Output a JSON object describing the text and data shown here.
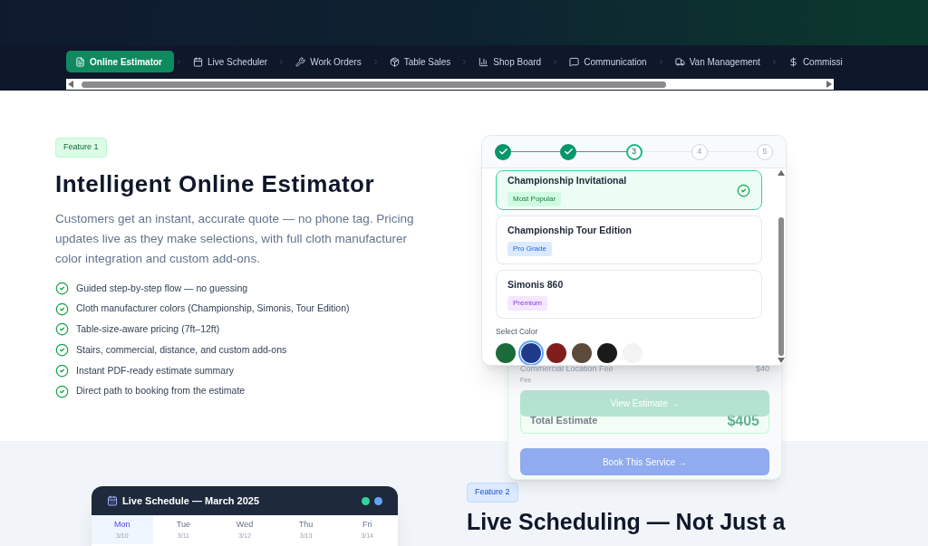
{
  "nav": {
    "tabs": [
      {
        "label": "Online Estimator",
        "selected": true
      },
      {
        "label": "Live Scheduler",
        "selected": false
      },
      {
        "label": "Work Orders",
        "selected": false
      },
      {
        "label": "Table Sales",
        "selected": false
      },
      {
        "label": "Shop Board",
        "selected": false
      },
      {
        "label": "Communication",
        "selected": false
      },
      {
        "label": "Van Management",
        "selected": false
      },
      {
        "label": "Commissi",
        "selected": false
      }
    ]
  },
  "feature_1": {
    "badge": "Feature 1",
    "title": "Intelligent Online Estimator",
    "description": "Customers get an instant, accurate quote — no phone tag. Pricing updates live as they make selections, with full cloth manufacturer color integration and custom add-ons.",
    "checklist": [
      "Guided step-by-step flow — no guessing",
      "Cloth manufacturer colors (Championship, Simonis, Tour Edition)",
      "Table-size-aware pricing (7ft–12ft)",
      "Stairs, commercial, distance, and custom add-ons",
      "Instant PDF-ready estimate summary",
      "Direct path to booking from the estimate"
    ]
  },
  "estimator": {
    "steps": [
      {
        "kind": "done"
      },
      {
        "kind": "done"
      },
      {
        "kind": "current",
        "label": "3"
      },
      {
        "kind": "upcoming",
        "label": "4"
      },
      {
        "kind": "upcoming",
        "label": "5"
      }
    ],
    "cloths": [
      {
        "name": "Championship Invitational",
        "tag": "Most Popular",
        "kind": "popular",
        "selected": true
      },
      {
        "name": "Championship Tour Edition",
        "tag": "Pro Grade",
        "kind": "pro",
        "selected": false
      },
      {
        "name": "Simonis 860",
        "tag": "Premium",
        "kind": "premium",
        "selected": false
      }
    ],
    "color_label": "Select Color",
    "colors": [
      {
        "color": "#1b6b3a",
        "selected": false
      },
      {
        "color": "#1e3a8a",
        "selected": true
      },
      {
        "color": "#7f1d1d",
        "selected": false
      },
      {
        "color": "#5c4a3a",
        "selected": false
      },
      {
        "color": "#1a1a1a",
        "selected": false
      },
      {
        "color": "#f3f3f3",
        "selected": false
      }
    ]
  },
  "summary": {
    "fee_name": "Commercial Location Fee",
    "fee_type": "Fee",
    "fee_amount": "$40",
    "view_button": "View Estimate →",
    "total_label": "Total Estimate",
    "total": "$405",
    "book_button": "Book This Service →"
  },
  "schedule": {
    "title": "Live Schedule — March 2025",
    "days": [
      {
        "day": "Mon",
        "date": "3/10",
        "selected": true
      },
      {
        "day": "Tue",
        "date": "3/11",
        "selected": false
      },
      {
        "day": "Wed",
        "date": "3/12",
        "selected": false
      },
      {
        "day": "Thu",
        "date": "3/13",
        "selected": false
      },
      {
        "day": "Fri",
        "date": "3/14",
        "selected": false
      }
    ]
  },
  "feature_2": {
    "badge": "Feature 2",
    "title": "Live Scheduling — Not Just a"
  }
}
